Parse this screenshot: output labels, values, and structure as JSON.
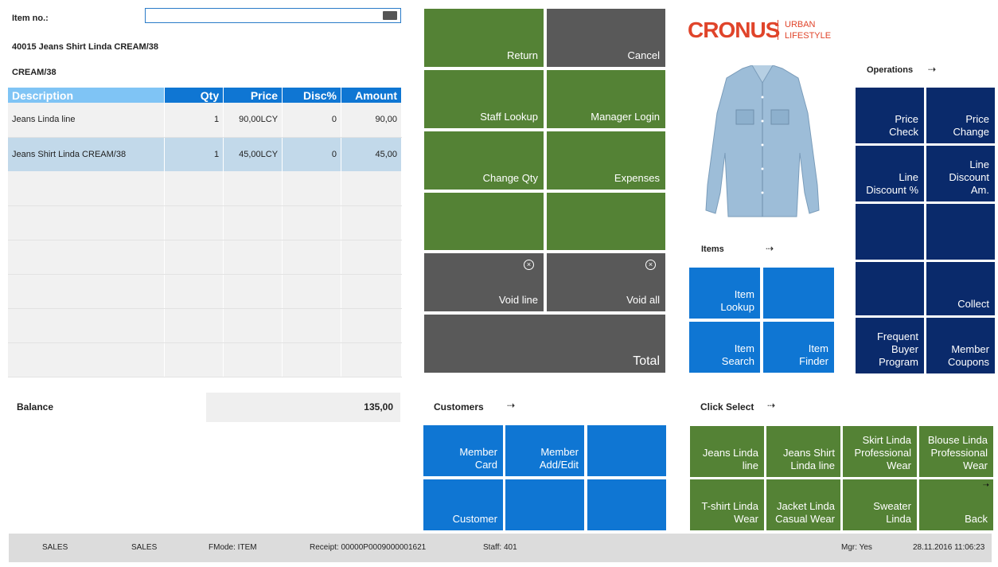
{
  "item_no": {
    "label": "Item no.:",
    "value": ""
  },
  "item_desc_line1": "40015 Jeans Shirt Linda CREAM/38",
  "item_desc_line2": "CREAM/38",
  "table": {
    "headers": [
      "Description",
      "Qty",
      "Price",
      "Disc%",
      "Amount"
    ],
    "rows": [
      [
        "Jeans Linda line",
        "1",
        "90,00LCY",
        "0",
        "90,00"
      ],
      [
        "Jeans Shirt Linda CREAM/38",
        "1",
        "45,00LCY",
        "0",
        "45,00"
      ]
    ]
  },
  "balance": {
    "label": "Balance",
    "value": "135,00"
  },
  "main_buttons": {
    "return": "Return",
    "cancel": "Cancel",
    "staff_lookup": "Staff Lookup",
    "manager_login": "Manager Login",
    "change_qty": "Change Qty",
    "expenses": "Expenses",
    "void_line": "Void line",
    "void_all": "Void all",
    "total": "Total"
  },
  "logo": {
    "brand": "CRONUS",
    "tagline_1": "URBAN",
    "tagline_2": "LIFESTYLE"
  },
  "operations": {
    "title": "Operations",
    "buttons": [
      "Price\nCheck",
      "Price\nChange",
      "Line\nDiscount %",
      "Line\nDiscount Am.",
      "",
      "",
      "",
      "Collect",
      "Frequent\nBuyer\nProgram",
      "Member\nCoupons"
    ]
  },
  "items": {
    "title": "Items",
    "buttons": [
      "Item\nLookup",
      "",
      "Item\nSearch",
      "Item\nFinder"
    ]
  },
  "customers": {
    "title": "Customers",
    "buttons": [
      "Member\nCard",
      "Member\nAdd/Edit",
      "",
      "Customer",
      "",
      ""
    ]
  },
  "click_select": {
    "title": "Click Select",
    "buttons": [
      "Jeans Linda\nline",
      "Jeans Shirt\nLinda line",
      "Skirt Linda\nProfessional\nWear",
      "Blouse Linda\nProfessional\nWear",
      "T-shirt Linda\nWear",
      "Jacket Linda\nCasual Wear",
      "Sweater Linda",
      "Back"
    ]
  },
  "status_bar": {
    "s1": "SALES",
    "s2": "SALES",
    "fmode": "FMode: ITEM",
    "receipt": "Receipt: 00000P0009000001621",
    "staff": "Staff: 401",
    "mgr": "Mgr: Yes",
    "datetime": "28.11.2016 11:06:23"
  },
  "arrow_glyph": "⇢",
  "colors": {
    "green": "#548235",
    "gray": "#595959",
    "blue": "#0f76d3",
    "navy": "#0a2a6b",
    "brand": "#e0442a"
  }
}
